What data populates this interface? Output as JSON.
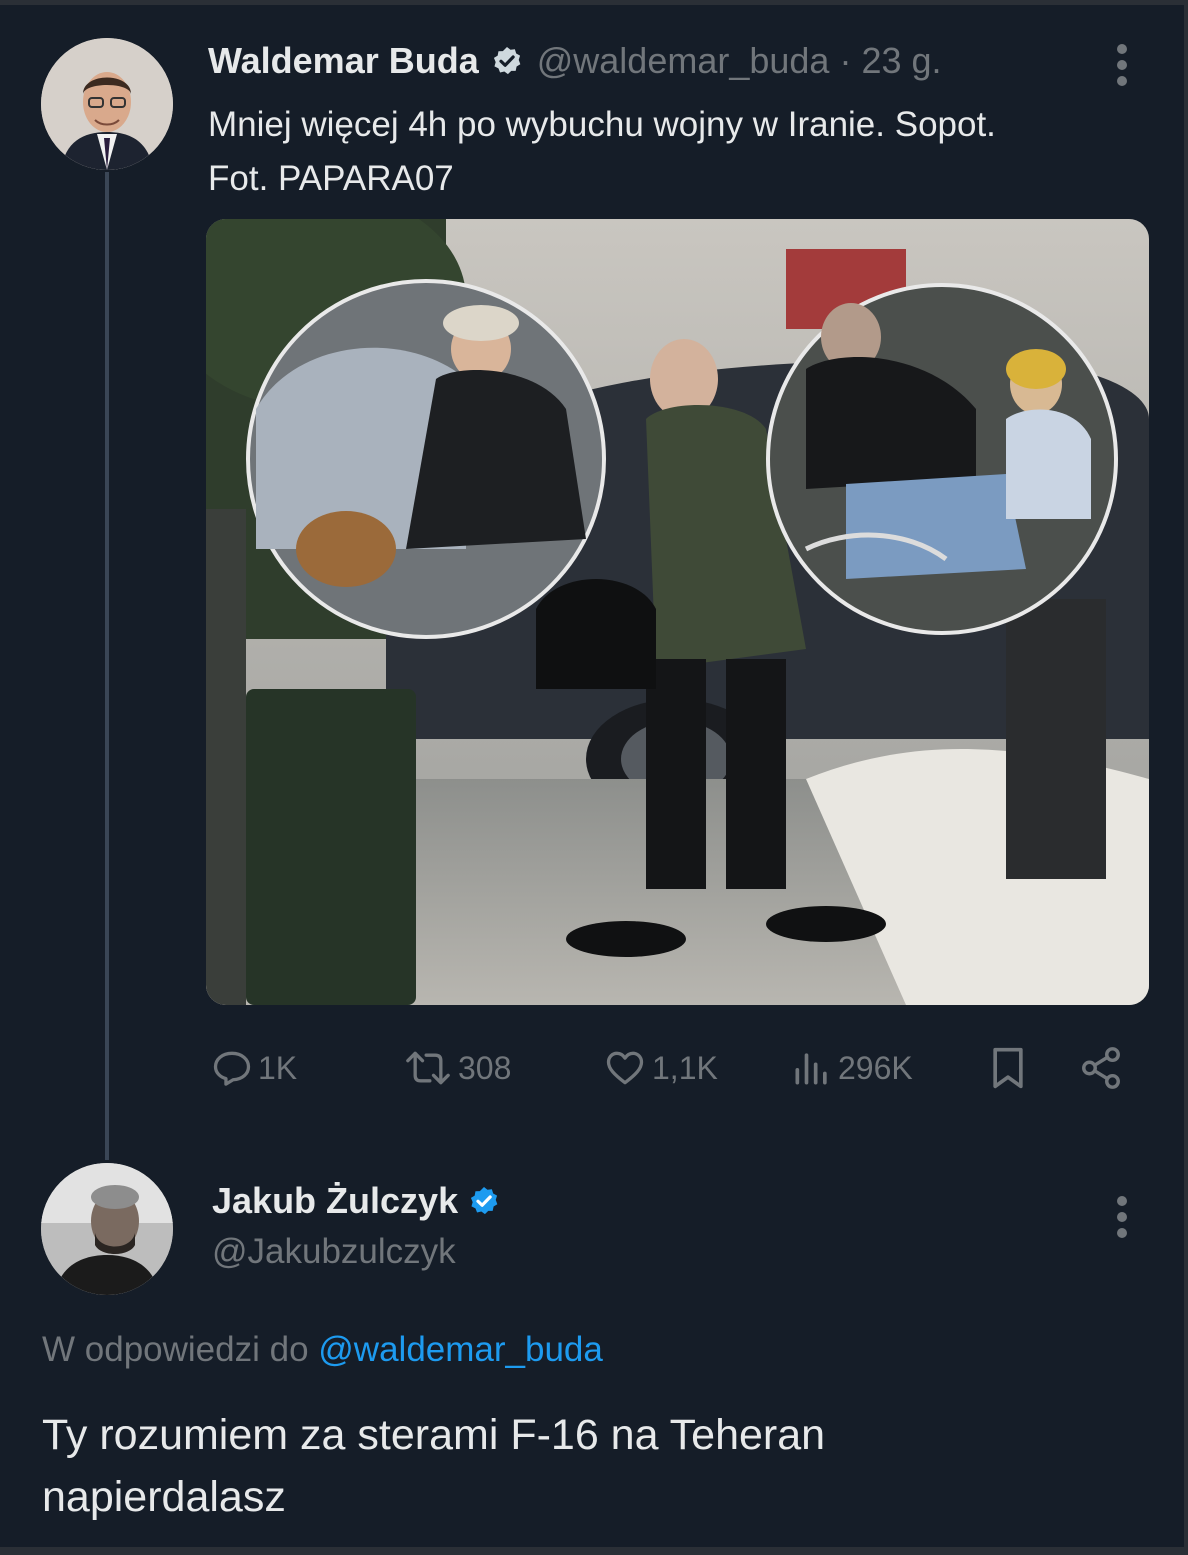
{
  "tweet": {
    "author": {
      "display_name": "Waldemar Buda",
      "handle": "@waldemar_buda",
      "separator": "·",
      "time": "23 g.",
      "verified": true,
      "verified_color": "#cfd9de"
    },
    "text_lines": [
      "Mniej więcej 4h po wybuchu wojny w Iranie. Sopot.",
      "Fot. PAPARA07"
    ],
    "media": {
      "icon": "photo-image"
    },
    "actions": {
      "replies": "1K",
      "reposts": "308",
      "likes": "1,1K",
      "views": "296K"
    },
    "icons": {
      "reply": "speech-bubble-icon",
      "repost": "repost-arrows-icon",
      "like": "heart-icon",
      "views": "bar-chart-icon",
      "bookmark": "bookmark-icon",
      "share": "share-icon",
      "more": "more-vertical-icon"
    }
  },
  "reply": {
    "author": {
      "display_name": "Jakub Żulczyk",
      "handle": "@Jakubzulczyk",
      "verified": true,
      "verified_color": "#1d9bf0"
    },
    "in_reply_to_prefix": "W odpowiedzi do",
    "in_reply_to_handle": "@waldemar_buda",
    "text_lines": [
      "Ty rozumiem za sterami F-16 na Teheran",
      "napierdalasz"
    ]
  },
  "colors": {
    "background": "#151d28",
    "text_primary": "#e7e9ea",
    "text_secondary": "#71767b",
    "link": "#1d9bf0",
    "thread_line": "#3a4656"
  }
}
